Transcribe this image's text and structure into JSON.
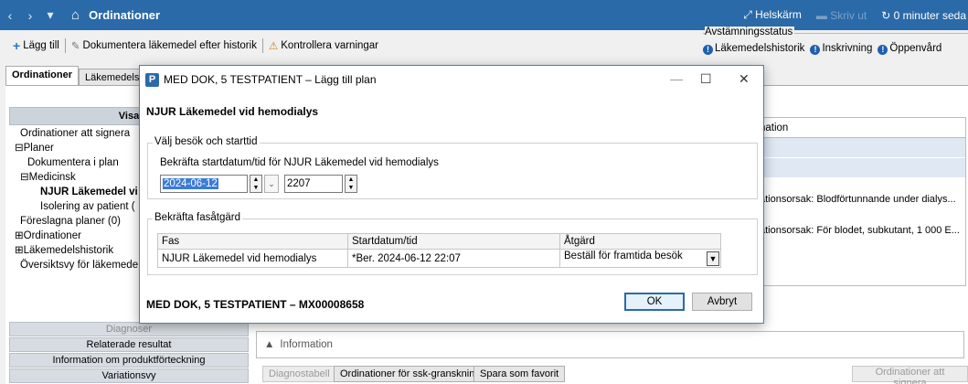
{
  "titlebar": {
    "back": "‹",
    "forward": "›",
    "menu": "▾",
    "title": "Ordinationer",
    "fullscreen": "Helskärm",
    "print": "Skriv ut",
    "timer": "0 minuter seda"
  },
  "toolbar": {
    "add": "Lägg till",
    "document": "Dokumentera läkemedel efter historik",
    "check": "Kontrollera varningar"
  },
  "avstamning": {
    "label": "Avstämningsstatus",
    "items": [
      "Läkemedelshistorik",
      "Inskrivning",
      "Öppenvård"
    ]
  },
  "tabs": [
    "Ordinationer",
    "Läkemedels"
  ],
  "left": {
    "header": "Visa",
    "tree": [
      "Ordinationer att signera",
      "Planer",
      "Dokumentera i plan",
      "Medicinsk",
      "NJUR Läkemedel vi",
      "Isolering av patient (",
      "Föreslagna planer (0)",
      "Ordinationer",
      "Läkemedelshistorik",
      "Översiktsvy för läkemede"
    ],
    "bottom": [
      "Diagnoser",
      "Relaterade resultat",
      "Information om produktförteckning",
      "Variationsvy"
    ]
  },
  "grid": {
    "header": "nation",
    "row1": "ationsorsak: Blodförtunnande under dialys...",
    "row2": "ationsorsak: För blodet, subkutant, 1 000 E..."
  },
  "info": {
    "label": "Information"
  },
  "buttons": {
    "diag": "Diagnostabell",
    "ssk": "Ordinationer för ssk-granskning",
    "fav": "Spara som favorit",
    "sign": "Ordinationer att signera"
  },
  "dialog": {
    "title": "MED DOK, 5 TESTPATIENT – Lägg till plan",
    "minimize": "—",
    "maximize": "☐",
    "close": "✕",
    "heading": "NJUR Läkemedel vid hemodialys",
    "group1_label": "Välj besök och starttid",
    "confirm_label": "Bekräfta startdatum/tid för NJUR Läkemedel vid hemodialys",
    "date": "2024-06-12",
    "time": "2207",
    "group2_label": "Bekräfta fasåtgärd",
    "table": {
      "headers": [
        "Fas",
        "Startdatum/tid",
        "Åtgärd"
      ],
      "rows": [
        [
          "NJUR Läkemedel vid hemodialys",
          "*Ber. 2024-06-12 22:07",
          "Beställ för framtida besök"
        ]
      ]
    },
    "patient": "MED DOK, 5 TESTPATIENT – MX00008658",
    "ok": "OK",
    "cancel": "Avbryt"
  }
}
